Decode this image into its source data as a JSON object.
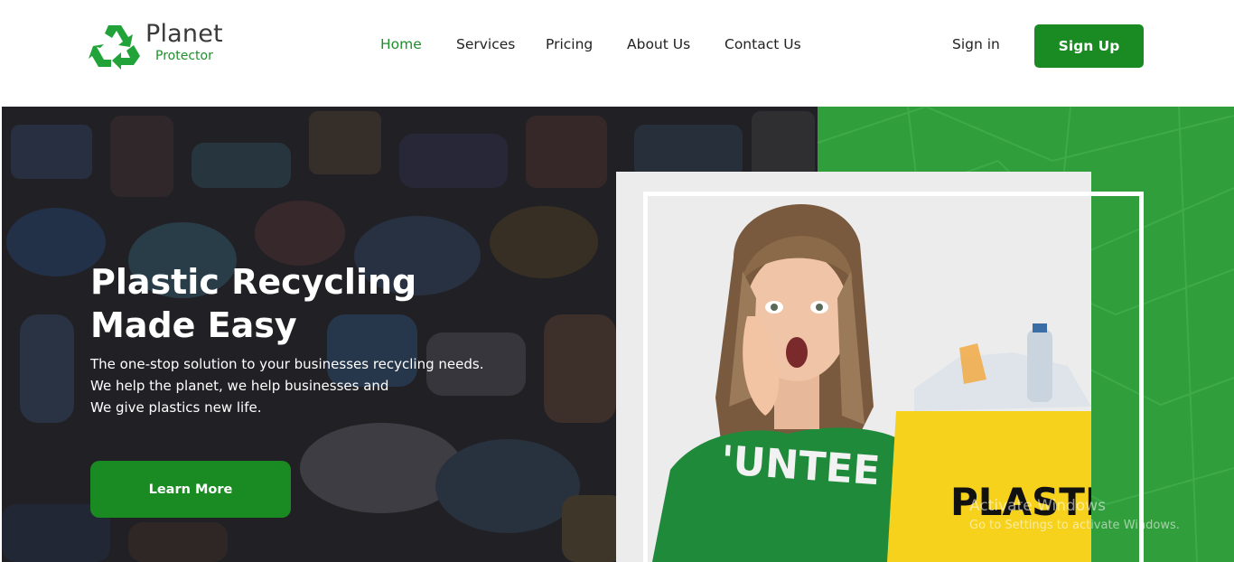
{
  "brand": {
    "name": "Planet",
    "tagline": "Protector"
  },
  "nav": {
    "items": [
      {
        "label": "Home",
        "active": true
      },
      {
        "label": "Services"
      },
      {
        "label": "Pricing"
      },
      {
        "label": "About Us"
      },
      {
        "label": "Contact Us"
      }
    ]
  },
  "auth": {
    "signin_label": "Sign in",
    "signup_label": "Sign Up"
  },
  "hero": {
    "title_line1": "Plastic Recycling",
    "title_line2": "Made Easy",
    "subtitle_line1": "The one-stop solution to your businesses recycling needs.",
    "subtitle_line2": "We help the planet, we help businesses and",
    "subtitle_line3": "We give plastics new life.",
    "cta_label": "Learn More",
    "photo": {
      "shirt_text": "'UNTEE",
      "bag_text": "PLASTI"
    }
  },
  "os_watermark": {
    "line1": "Activate Windows",
    "line2": "Go to Settings to activate Windows."
  },
  "colors": {
    "accent": "#1a8a22",
    "nav_active": "#1f8f2c",
    "hero_green": "#2e9c3a"
  }
}
